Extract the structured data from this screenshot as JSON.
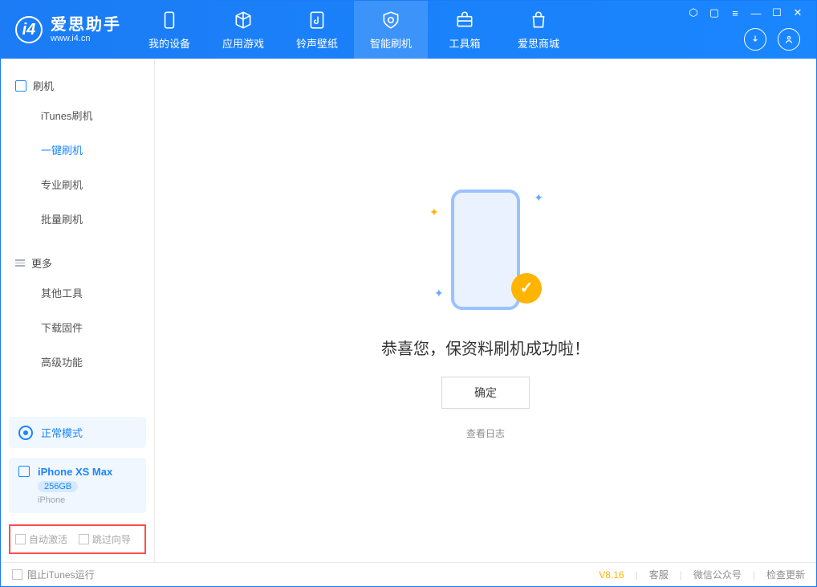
{
  "app": {
    "name_cn": "爱思助手",
    "name_en": "www.i4.cn"
  },
  "tabs": [
    {
      "label": "我的设备"
    },
    {
      "label": "应用游戏"
    },
    {
      "label": "铃声壁纸"
    },
    {
      "label": "智能刷机"
    },
    {
      "label": "工具箱"
    },
    {
      "label": "爱思商城"
    }
  ],
  "sidebar": {
    "section1": {
      "title": "刷机",
      "items": [
        "iTunes刷机",
        "一键刷机",
        "专业刷机",
        "批量刷机"
      ]
    },
    "section2": {
      "title": "更多",
      "items": [
        "其他工具",
        "下载固件",
        "高级功能"
      ]
    }
  },
  "mode": {
    "label": "正常模式"
  },
  "device": {
    "name": "iPhone XS Max",
    "storage": "256GB",
    "type": "iPhone"
  },
  "checkboxes": {
    "auto_activate": "自动激活",
    "skip_guide": "跳过向导"
  },
  "main": {
    "success_msg": "恭喜您，保资料刷机成功啦！",
    "ok": "确定",
    "view_log": "查看日志"
  },
  "footer": {
    "block_itunes": "阻止iTunes运行",
    "version": "V8.16",
    "service": "客服",
    "wechat": "微信公众号",
    "update": "检查更新"
  }
}
